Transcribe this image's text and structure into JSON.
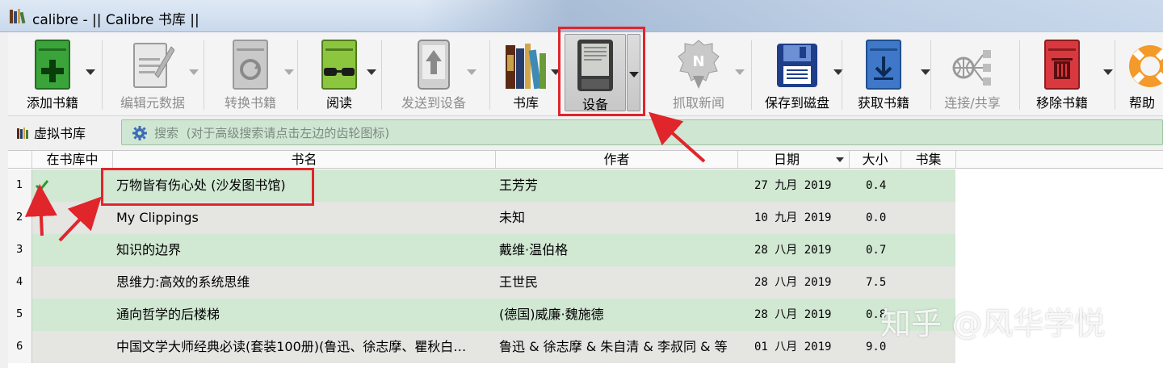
{
  "window": {
    "title": "calibre - || Calibre 书库 ||"
  },
  "toolbar": {
    "add": {
      "label": "添加书籍",
      "icon": "add-book-icon"
    },
    "edit": {
      "label": "编辑元数据",
      "icon": "edit-metadata-icon"
    },
    "convert": {
      "label": "转换书籍",
      "icon": "convert-book-icon"
    },
    "view": {
      "label": "阅读",
      "icon": "read-book-icon"
    },
    "send": {
      "label": "发送到设备",
      "icon": "send-to-device-icon"
    },
    "library": {
      "label": "书库",
      "icon": "library-icon"
    },
    "device": {
      "label": "设备",
      "icon": "ereader-device-icon"
    },
    "news": {
      "label": "抓取新闻",
      "icon": "fetch-news-icon"
    },
    "save": {
      "label": "保存到磁盘",
      "icon": "save-disk-icon"
    },
    "get": {
      "label": "获取书籍",
      "icon": "get-books-icon"
    },
    "connect": {
      "label": "连接/共享",
      "icon": "connect-share-icon"
    },
    "remove": {
      "label": "移除书籍",
      "icon": "remove-book-icon"
    },
    "help": {
      "label": "帮助",
      "icon": "help-lifebuoy-icon"
    }
  },
  "search": {
    "virtual_library": "虚拟书库",
    "label": "搜索",
    "placeholder": "(对于高级搜索请点击左边的齿轮图标)"
  },
  "columns": [
    "在书库中",
    "书名",
    "作者",
    "日期",
    "大小",
    "书集"
  ],
  "books": [
    {
      "num": "1",
      "on_device": true,
      "title": "万物皆有伤心处 (沙发图书馆)",
      "author": "王芳芳",
      "date": "27 九月 2019",
      "size": "0.4"
    },
    {
      "num": "2",
      "on_device": false,
      "title": "My Clippings",
      "author": "未知",
      "date": "10 九月 2019",
      "size": "0.0"
    },
    {
      "num": "3",
      "on_device": false,
      "title": "知识的边界",
      "author": "戴维·温伯格",
      "date": "28 八月 2019",
      "size": "0.7"
    },
    {
      "num": "4",
      "on_device": false,
      "title": "思维力:高效的系统思维",
      "author": "王世民",
      "date": "28 八月 2019",
      "size": "7.5"
    },
    {
      "num": "5",
      "on_device": false,
      "title": "通向哲学的后楼梯",
      "author": "(德国)威廉·魏施德",
      "date": "28 八月 2019",
      "size": "0.8"
    },
    {
      "num": "6",
      "on_device": false,
      "title": "中国文学大师经典必读(套装100册)(鲁迅、徐志摩、瞿秋白…",
      "author": "鲁迅 & 徐志摩 & 朱自清 & 李叔同 & 等",
      "date": "01 八月 2019",
      "size": "9.0"
    }
  ],
  "watermark": "知乎 @风华学悦",
  "colors": {
    "highlight_red": "#e0252b",
    "row_green": "#d1e8d3",
    "row_gray": "#e5e5e2"
  }
}
